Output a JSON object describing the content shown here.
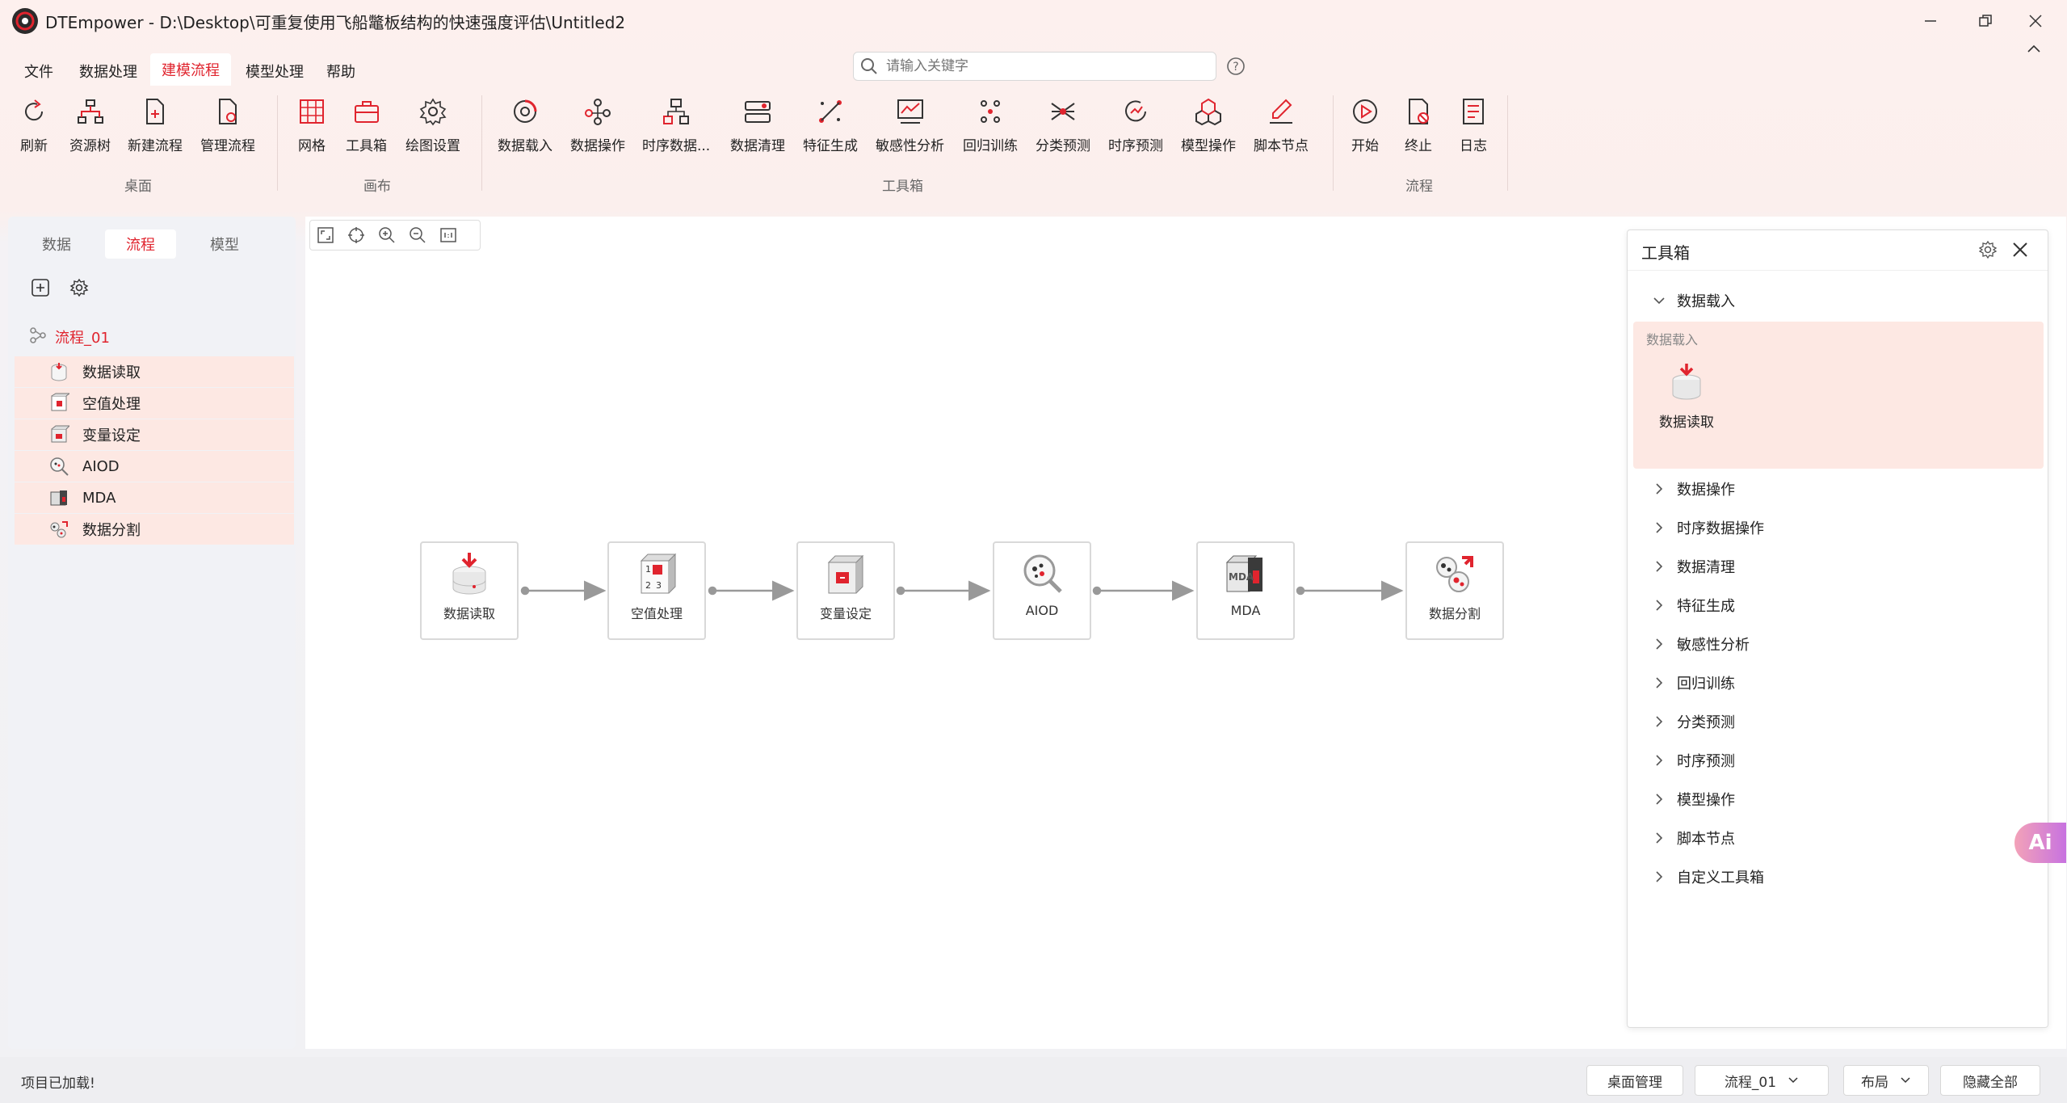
{
  "window": {
    "title": "DTEmpower - D:\\Desktop\\可重复使用飞船鼈板结构的快速强度评估\\Untitled2"
  },
  "menu": [
    "文件",
    "数据处理",
    "建模流程",
    "模型处理",
    "帮助"
  ],
  "search": {
    "placeholder": "请输入关键字"
  },
  "ribbon": {
    "desktop": {
      "group": "桌面",
      "items": [
        "刷新",
        "资源树",
        "新建流程",
        "管理流程"
      ]
    },
    "canvas": {
      "group": "画布",
      "items": [
        "网格",
        "工具箱",
        "绘图设置"
      ]
    },
    "toolbox": {
      "group": "工具箱",
      "items": [
        "数据载入",
        "数据操作",
        "时序数据...",
        "数据清理",
        "特征生成",
        "敏感性分析",
        "回归训练",
        "分类预测",
        "时序预测",
        "模型操作",
        "脚本节点"
      ]
    },
    "flow": {
      "group": "流程",
      "items": [
        "开始",
        "终止",
        "日志"
      ]
    }
  },
  "left_panel": {
    "tabs": [
      "数据",
      "流程",
      "模型"
    ],
    "flow_name": "流程_01",
    "items": [
      "数据读取",
      "空值处理",
      "变量设定",
      "AIOD",
      "MDA",
      "数据分割"
    ]
  },
  "flow_nodes": [
    "数据读取",
    "空值处理",
    "变量设定",
    "AIOD",
    "MDA",
    "数据分割"
  ],
  "toolbox_panel": {
    "title": "工具箱",
    "expanded": {
      "name": "数据载入",
      "subtitle": "数据载入",
      "tool": "数据读取"
    },
    "categories": [
      "数据操作",
      "时序数据操作",
      "数据清理",
      "特征生成",
      "敏感性分析",
      "回归训练",
      "分类预测",
      "时序预测",
      "模型操作",
      "脚本节点",
      "自定义工具箱"
    ]
  },
  "ai_badge": "Ai",
  "status": {
    "message": "项目已加载!",
    "buttons": {
      "desktop_manage": "桌面管理",
      "flow_select": "流程_01",
      "layout": "布局",
      "hide_all": "隐藏全部"
    }
  },
  "colors": {
    "accent": "#e0242e",
    "tree_highlight": "#fde8e3"
  }
}
